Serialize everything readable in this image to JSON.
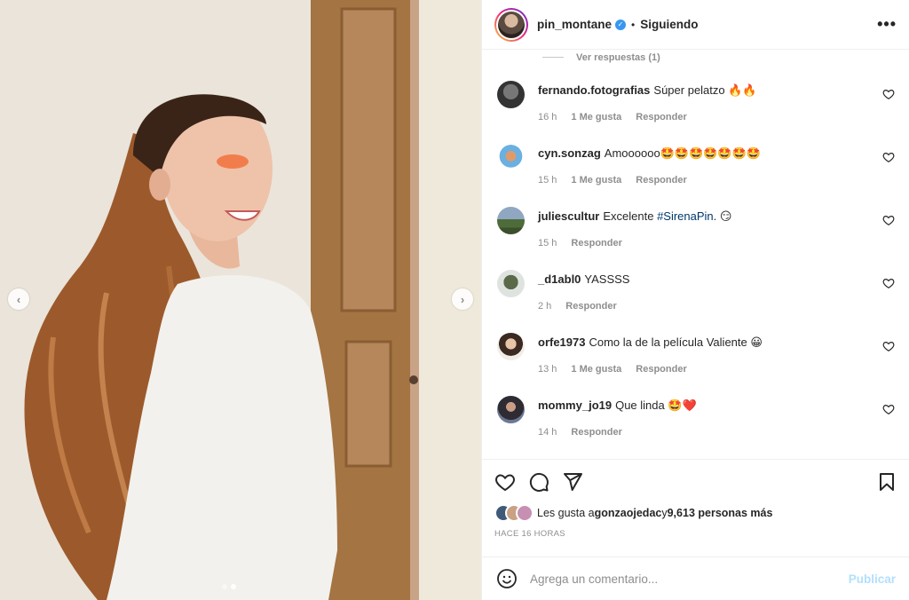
{
  "header": {
    "username": "pin_montane",
    "separator": "•",
    "follow_status": "Siguiendo",
    "more_label": "•••"
  },
  "view_replies": "Ver respuestas (1)",
  "comments": [
    {
      "user": "fernando.fotografias",
      "text": "Súper pelatzo 🔥🔥",
      "tag": "",
      "tail": "",
      "time": "16 h",
      "likes": "1 Me gusta",
      "reply": "Responder"
    },
    {
      "user": "cyn.sonzag",
      "text": "Amoooooo🤩🤩🤩🤩🤩🤩🤩",
      "tag": "",
      "tail": "",
      "time": "15 h",
      "likes": "1 Me gusta",
      "reply": "Responder"
    },
    {
      "user": "juliescultur",
      "text": "Excelente ",
      "tag": "#SirenaPin",
      "tail": ". 😏",
      "time": "15 h",
      "likes": "",
      "reply": "Responder"
    },
    {
      "user": "_d1abl0",
      "text": "YASSSS",
      "tag": "",
      "tail": "",
      "time": "2 h",
      "likes": "",
      "reply": "Responder"
    },
    {
      "user": "orfe1973",
      "text": "Como la de la película Valiente 😀",
      "tag": "",
      "tail": "",
      "time": "13 h",
      "likes": "1 Me gusta",
      "reply": "Responder"
    },
    {
      "user": "mommy_jo19",
      "text": "Que linda 🤩❤️",
      "tag": "",
      "tail": "",
      "time": "14 h",
      "likes": "",
      "reply": "Responder"
    }
  ],
  "likes": {
    "prefix": "Les gusta a ",
    "user": "gonzaojedac",
    "middle": " y ",
    "count": "9,613 personas más"
  },
  "timestamp": "HACE 16 HORAS",
  "add_comment": {
    "placeholder": "Agrega un comentario...",
    "publish": "Publicar"
  },
  "colors": {
    "link": "#00376b",
    "publish_disabled": "#b2dffc",
    "muted": "#8e8e8e"
  }
}
